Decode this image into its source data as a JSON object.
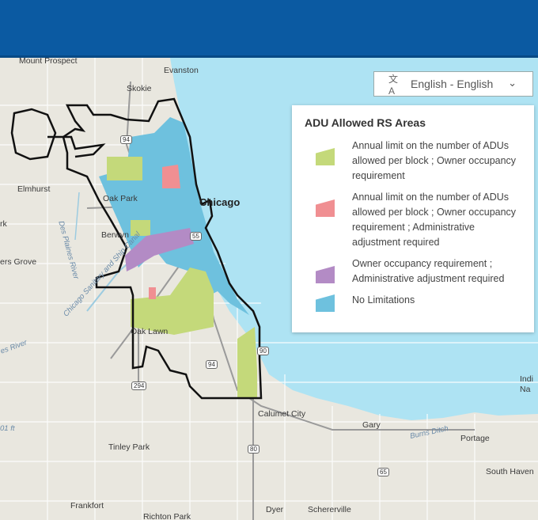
{
  "language_selector": {
    "value": "English - English"
  },
  "legend": {
    "title": "ADU Allowed RS Areas",
    "items": [
      {
        "label": "Annual limit on the number of ADUs allowed per block ; Owner occupancy requirement",
        "color": "#c4d97a"
      },
      {
        "label": "Annual limit on the number of ADUs allowed per block ; Owner occupancy requirement ; Administrative adjustment required",
        "color": "#f08f92"
      },
      {
        "label": "Owner occupancy requirement ; Administrative adjustment required",
        "color": "#b38bc5"
      },
      {
        "label": "No Limitations",
        "color": "#6ec1de"
      }
    ]
  },
  "map": {
    "places": {
      "mount_prospect": "Mount Prospect",
      "evanston": "Evanston",
      "skokie": "Skokie",
      "elmhurst": "Elmhurst",
      "oak_park": "Oak Park",
      "chicago": "Chicago",
      "berwyn": "Berwyn",
      "ers_grove": "ers Grove",
      "rk": "rk",
      "oak_lawn": "Oak Lawn",
      "calumet_city": "Calumet City",
      "gary": "Gary",
      "portage": "Portage",
      "tinley_park": "Tinley Park",
      "south_haven": "South Haven",
      "frankfort": "Frankfort",
      "richton_park": "Richton Park",
      "dyer": "Dyer",
      "schererville": "Schererville",
      "indiana_1": "Indi",
      "indiana_2": "Na",
      "burns_ditch": "Burns Ditch",
      "des_plaines_river": "Des Plaines River",
      "sanitary_canal": "Chicago Sanitary and Ship Canal",
      "s_river": "es River",
      "ft": "01 ft"
    },
    "highways": [
      "94",
      "55",
      "94",
      "294",
      "80",
      "65",
      "90"
    ]
  }
}
